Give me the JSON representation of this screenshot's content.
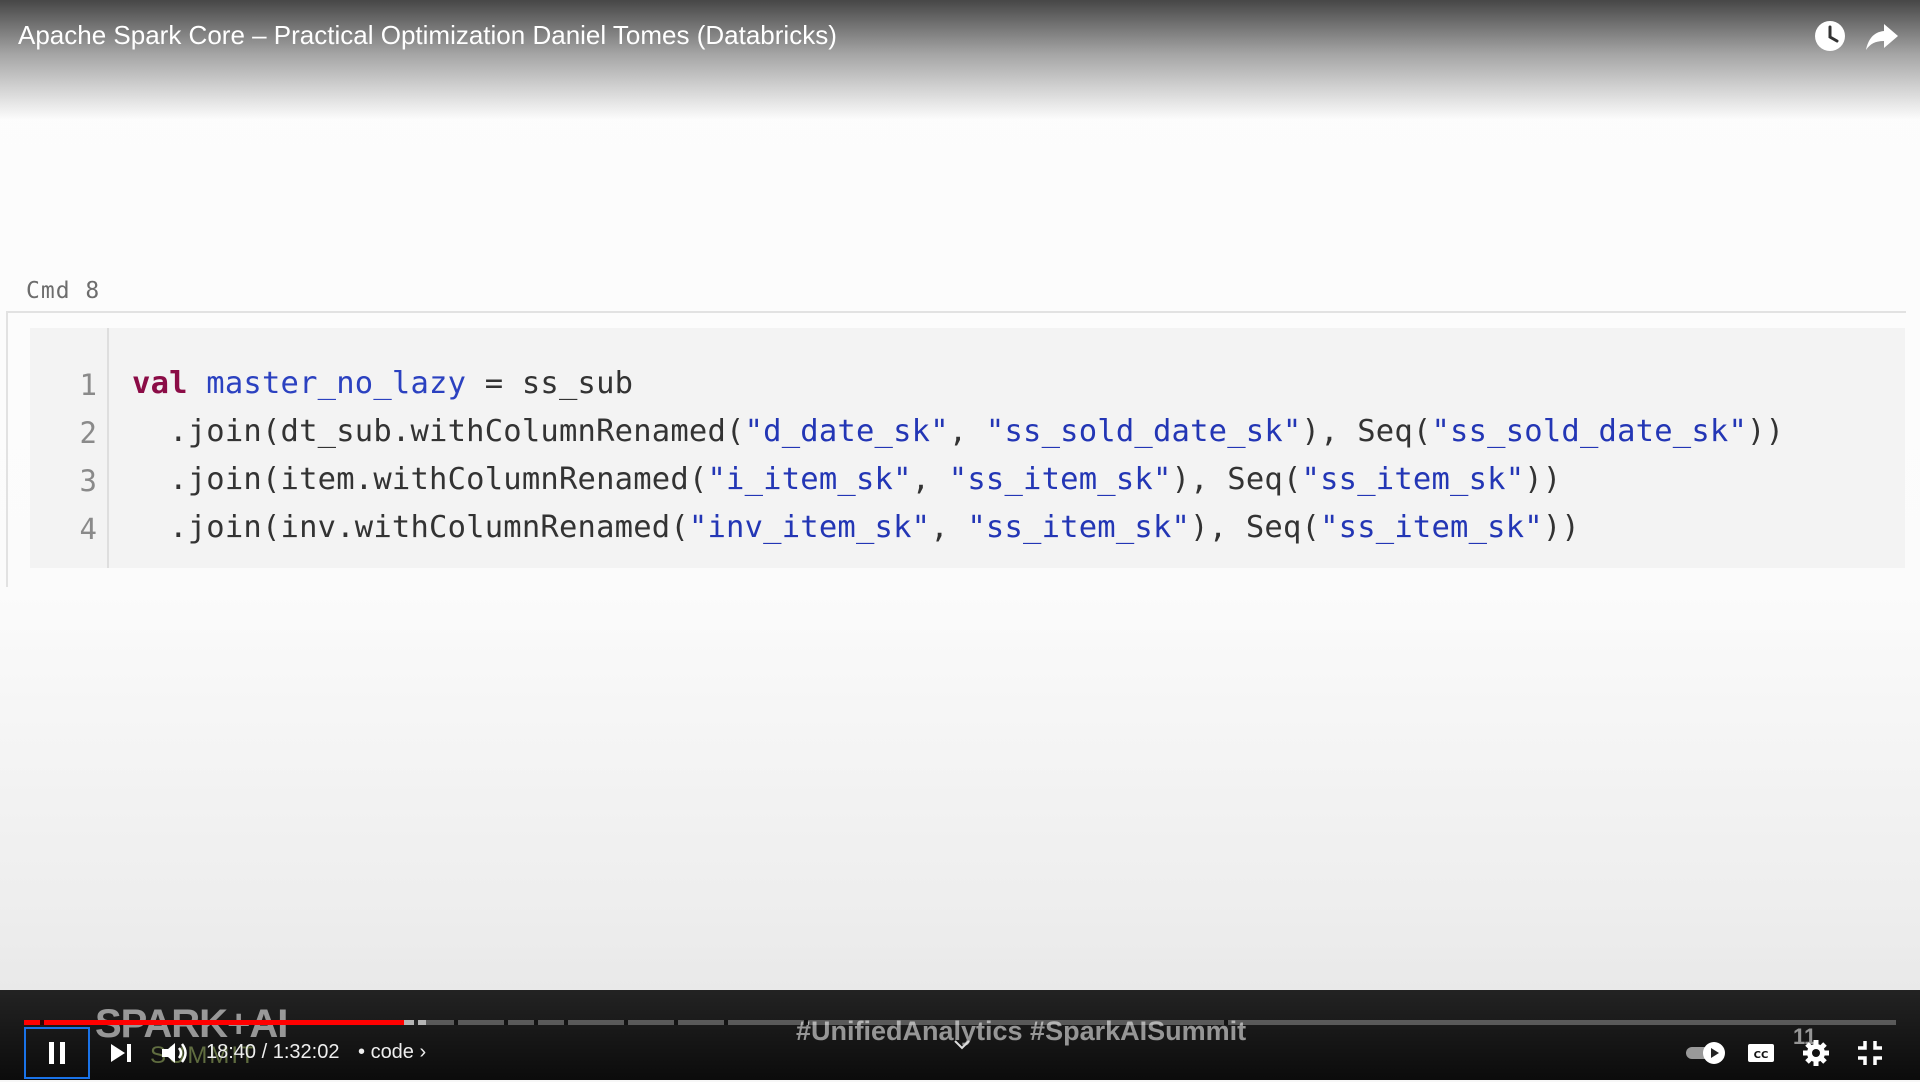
{
  "video": {
    "title": "Apache Spark Core – Practical Optimization Daniel Tomes (Databricks)",
    "current_time": "18:40",
    "duration": "1:32:02",
    "time_text": "18:40 / 1:32:02",
    "chapter": "code",
    "progress_fraction": 0.203,
    "buffered_fraction": 0.215
  },
  "notebook": {
    "cmd_label": "Cmd 8",
    "line_numbers": [
      "1",
      "2",
      "3",
      "4"
    ],
    "lines": [
      "val master_no_lazy = ss_sub",
      "  .join(dt_sub.withColumnRenamed(\"d_date_sk\", \"ss_sold_date_sk\"), Seq(\"ss_sold_date_sk\"))",
      "  .join(item.withColumnRenamed(\"i_item_sk\", \"ss_item_sk\"), Seq(\"ss_item_sk\"))",
      "  .join(inv.withColumnRenamed(\"inv_item_sk\", \"ss_item_sk\"), Seq(\"ss_item_sk\"))"
    ]
  },
  "watermark": {
    "logo_text": "SPARK+AI",
    "logo_sub": "SUMMIT",
    "hashtags": "#UnifiedAnalytics #SparkAISummit",
    "slide_number": "11"
  },
  "icons": {
    "watch_later": "clock-icon",
    "share": "share-icon",
    "play_pause": "pause-icon",
    "next": "next-icon",
    "volume": "volume-icon",
    "autoplay": "autoplay-toggle-icon",
    "captions": "cc-icon",
    "settings": "gear-icon",
    "fullscreen": "exit-fullscreen-icon"
  },
  "colors": {
    "progress_played": "#ff0000",
    "keyword": "#8b0c46",
    "string": "#2336b5",
    "focus_ring": "#1a73e8"
  }
}
